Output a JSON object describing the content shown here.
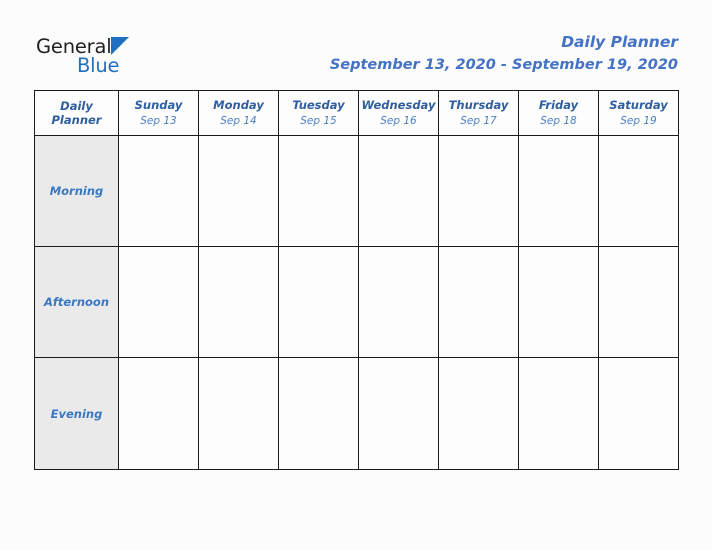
{
  "brand": {
    "word_primary": "General",
    "word_secondary": "Blue",
    "triangle_icon": "triangle-right-icon",
    "primary_color": "#231f20",
    "secondary_color": "#1f70c1"
  },
  "header": {
    "title": "Daily Planner",
    "date_range": "September 13, 2020 - September 19, 2020",
    "title_color": "#4472c4"
  },
  "table": {
    "corner_label_line1": "Daily",
    "corner_label_line2": "Planner",
    "header_bg": "#dfe9d0",
    "row_label_bg": "#eaeaea",
    "border_color": "#1b1b1b",
    "day_name_color": "#2f5f9e",
    "day_date_color": "#4a80c4",
    "row_label_color": "#3a78c2",
    "columns": [
      {
        "name": "Sunday",
        "date": "Sep 13"
      },
      {
        "name": "Monday",
        "date": "Sep 14"
      },
      {
        "name": "Tuesday",
        "date": "Sep 15"
      },
      {
        "name": "Wednesday",
        "date": "Sep 16"
      },
      {
        "name": "Thursday",
        "date": "Sep 17"
      },
      {
        "name": "Friday",
        "date": "Sep 18"
      },
      {
        "name": "Saturday",
        "date": "Sep 19"
      }
    ],
    "rows": [
      {
        "label": "Morning",
        "cells": [
          "",
          "",
          "",
          "",
          "",
          "",
          ""
        ]
      },
      {
        "label": "Afternoon",
        "cells": [
          "",
          "",
          "",
          "",
          "",
          "",
          ""
        ]
      },
      {
        "label": "Evening",
        "cells": [
          "",
          "",
          "",
          "",
          "",
          "",
          ""
        ]
      }
    ]
  }
}
